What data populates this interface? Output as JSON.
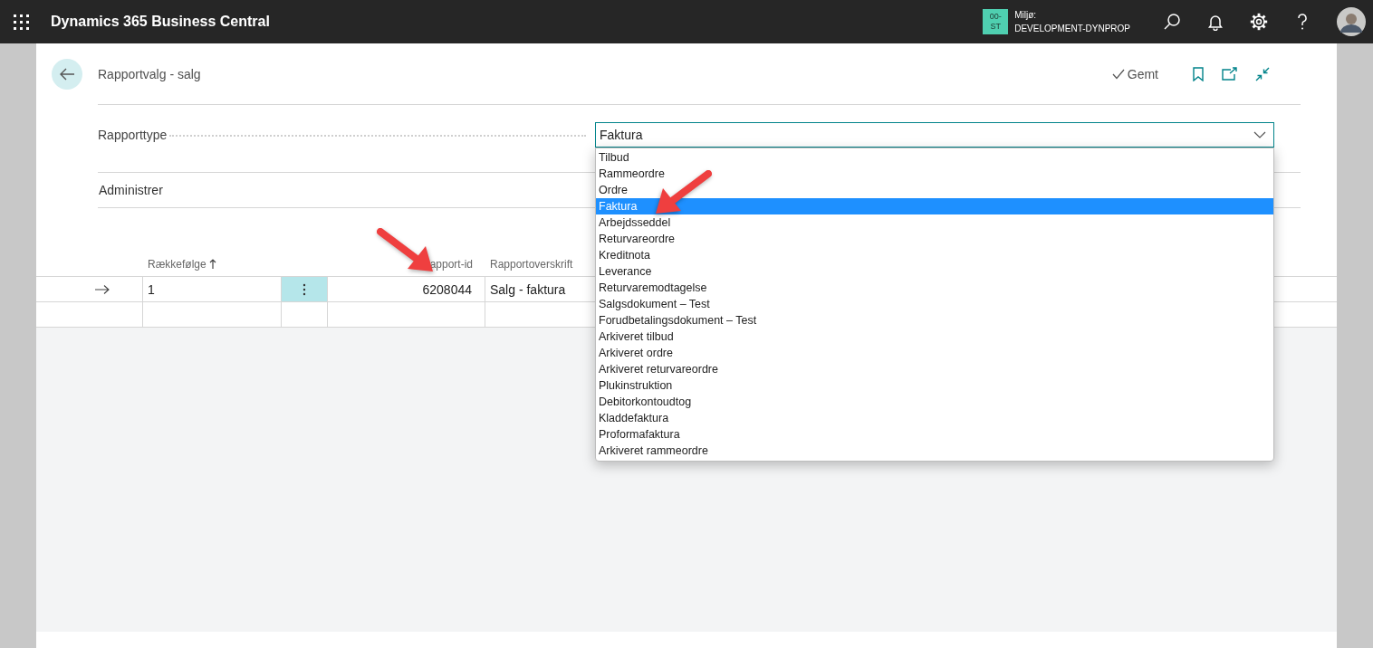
{
  "app_bar": {
    "title": "Dynamics 365 Business Central",
    "environment": {
      "badge_lines": [
        "00-",
        "ST"
      ],
      "label": "Miljø:",
      "name": "DEVELOPMENT-DYNPROP"
    }
  },
  "page": {
    "title": "Rapportvalg - salg",
    "save_status": "Gemt"
  },
  "field": {
    "label": "Rapporttype",
    "value": "Faktura",
    "expanded": true,
    "options": [
      {
        "label": "Tilbud",
        "selected": false
      },
      {
        "label": "Rammeordre",
        "selected": false
      },
      {
        "label": "Ordre",
        "selected": false
      },
      {
        "label": "Faktura",
        "selected": true
      },
      {
        "label": "Arbejdsseddel",
        "selected": false
      },
      {
        "label": "Returvareordre",
        "selected": false
      },
      {
        "label": "Kreditnota",
        "selected": false
      },
      {
        "label": "Leverance",
        "selected": false
      },
      {
        "label": "Returvaremodtagelse",
        "selected": false
      },
      {
        "label": "Salgsdokument – Test",
        "selected": false
      },
      {
        "label": "Forudbetalingsdokument – Test",
        "selected": false
      },
      {
        "label": "Arkiveret tilbud",
        "selected": false
      },
      {
        "label": "Arkiveret ordre",
        "selected": false
      },
      {
        "label": "Arkiveret returvareordre",
        "selected": false
      },
      {
        "label": "Plukinstruktion",
        "selected": false
      },
      {
        "label": "Debitorkontoudtog",
        "selected": false
      },
      {
        "label": "Kladdefaktura",
        "selected": false
      },
      {
        "label": "Proformafaktura",
        "selected": false
      },
      {
        "label": "Arkiveret rammeordre",
        "selected": false
      }
    ]
  },
  "action": "Administrer",
  "table": {
    "columns": [
      {
        "label": "Rækkefølge",
        "sorted": true
      },
      {
        "label": "apport-id",
        "sorted": false
      },
      {
        "label": "Rapportoverskrift",
        "sorted": false
      }
    ],
    "rows": [
      {
        "order": "1",
        "report_id": "6208044",
        "caption": "Salg - faktura",
        "current": true
      }
    ]
  },
  "callouts": [
    {
      "kind": "arrow"
    },
    {
      "kind": "arrow"
    }
  ]
}
